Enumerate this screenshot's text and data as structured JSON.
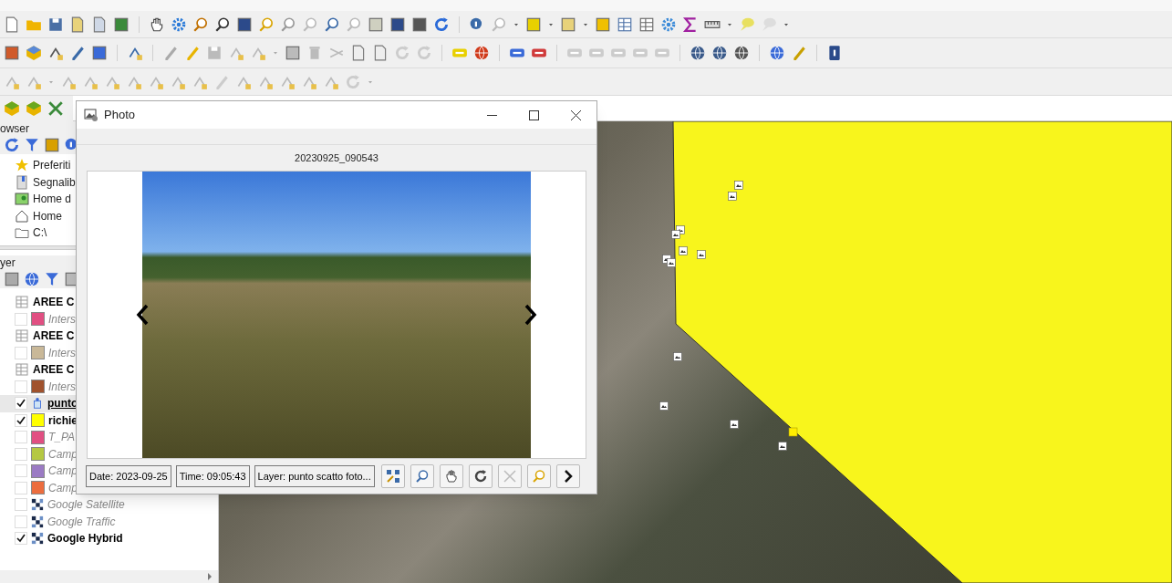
{
  "browser_panel": {
    "title": "owser",
    "items": [
      {
        "label": "Preferiti",
        "kind": "star"
      },
      {
        "label": "Segnalib",
        "kind": "bookmark"
      },
      {
        "label": "Home d",
        "kind": "project-home"
      },
      {
        "label": "Home",
        "kind": "home"
      },
      {
        "label": "C:\\",
        "kind": "drive"
      }
    ]
  },
  "layers_panel": {
    "title": "yer",
    "layers": [
      {
        "label": "AREE C",
        "kind": "table",
        "selected": false
      },
      {
        "label": "Inters",
        "kind": "fill",
        "checked": false,
        "color": "#e14f82",
        "selected": false
      },
      {
        "label": "AREE C",
        "kind": "table",
        "selected": false
      },
      {
        "label": "Inters",
        "kind": "fill",
        "checked": false,
        "color": "#c9b898",
        "selected": false
      },
      {
        "label": "AREE C",
        "kind": "table",
        "selected": false
      },
      {
        "label": "Inters",
        "kind": "fill",
        "checked": false,
        "color": "#a0522d",
        "selected": false
      },
      {
        "label": "punto",
        "kind": "point",
        "checked": true,
        "selected": true
      },
      {
        "label": "richie",
        "kind": "fill",
        "checked": true,
        "color": "#ffff00",
        "selected": false
      },
      {
        "label": "T_PA",
        "kind": "fill",
        "checked": false,
        "color": "#e14f82",
        "selected": false
      },
      {
        "label": "Camp",
        "kind": "fill",
        "checked": false,
        "color": "#b5c842",
        "selected": false
      },
      {
        "label": "Camp",
        "kind": "fill",
        "checked": false,
        "color": "#9b7bc4",
        "selected": false
      },
      {
        "label": "Camp",
        "kind": "fill",
        "checked": false,
        "color": "#ec6d3e",
        "selected": false
      },
      {
        "label": "Google Satellite",
        "kind": "raster",
        "checked": false,
        "selected": false
      },
      {
        "label": "Google Traffic",
        "kind": "raster",
        "checked": false,
        "selected": false
      },
      {
        "label": "Google Hybrid",
        "kind": "raster",
        "checked": true,
        "selected": false
      }
    ]
  },
  "photo_dialog": {
    "title": "Photo",
    "filename": "20230925_090543",
    "date": "Date: 2023-09-25",
    "time": "Time: 09:05:43",
    "layer": "Layer: punto scatto foto..."
  }
}
